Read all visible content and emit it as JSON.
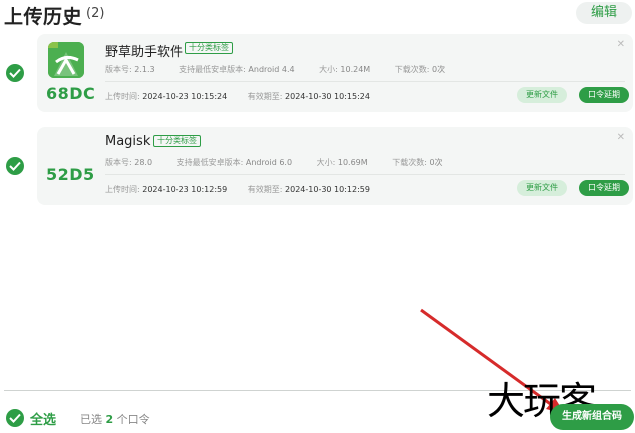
{
  "header": {
    "title": "上传历史",
    "count": "(2)",
    "edit_label": "编辑"
  },
  "uploads": [
    {
      "code": "68DC",
      "name": "野草助手软件",
      "tag": "十分类标签",
      "version_label": "版本号:",
      "version": "2.1.3",
      "min_android_label": "支持最低安卓版本:",
      "min_android": "Android 4.4",
      "size_label": "大小:",
      "size": "10.24M",
      "downloads_label": "下载次数:",
      "downloads": "0次",
      "upload_time_label": "上传时间:",
      "upload_time": "2024-10-23 10:15:24",
      "expiry_label": "有效期至:",
      "expiry": "2024-10-30 10:15:24",
      "update_label": "更新文件",
      "extend_label": "口令延期",
      "close_icon": "close-icon"
    },
    {
      "code": "52D5",
      "name": "Magisk",
      "tag": "十分类标签",
      "version_label": "版本号:",
      "version": "28.0",
      "min_android_label": "支持最低安卓版本:",
      "min_android": "Android 6.0",
      "size_label": "大小:",
      "size": "10.69M",
      "downloads_label": "下载次数:",
      "downloads": "0次",
      "upload_time_label": "上传时间:",
      "upload_time": "2024-10-23 10:12:59",
      "expiry_label": "有效期至:",
      "expiry": "2024-10-30 10:12:59",
      "update_label": "更新文件",
      "extend_label": "口令延期",
      "close_icon": "close-icon"
    }
  ],
  "footer": {
    "select_all": "全选",
    "selected_prefix": "已选",
    "selected_count": "2",
    "selected_suffix": "个口令",
    "generate_label": "生成新组合码"
  },
  "watermark": "大玩客",
  "colors": {
    "accent": "#2e9d46",
    "card_bg": "#f4f6f5",
    "arrow": "#d62b2b"
  }
}
